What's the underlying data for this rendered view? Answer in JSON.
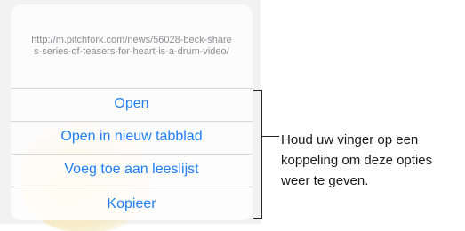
{
  "sheet": {
    "url": "http://m.pitchfork.com/news/56028-beck-shares-series-of-teasers-for-heart-is-a-drum-video/",
    "actions": [
      {
        "label": "Open"
      },
      {
        "label": "Open in nieuw tabblad"
      },
      {
        "label": "Voeg toe aan leeslijst"
      },
      {
        "label": "Kopieer"
      }
    ]
  },
  "callout": {
    "text": "Houd uw vinger op een koppeling om deze opties weer te geven."
  },
  "colors": {
    "action_blue": "#1f7ef4",
    "url_gray": "#8e8e93"
  }
}
